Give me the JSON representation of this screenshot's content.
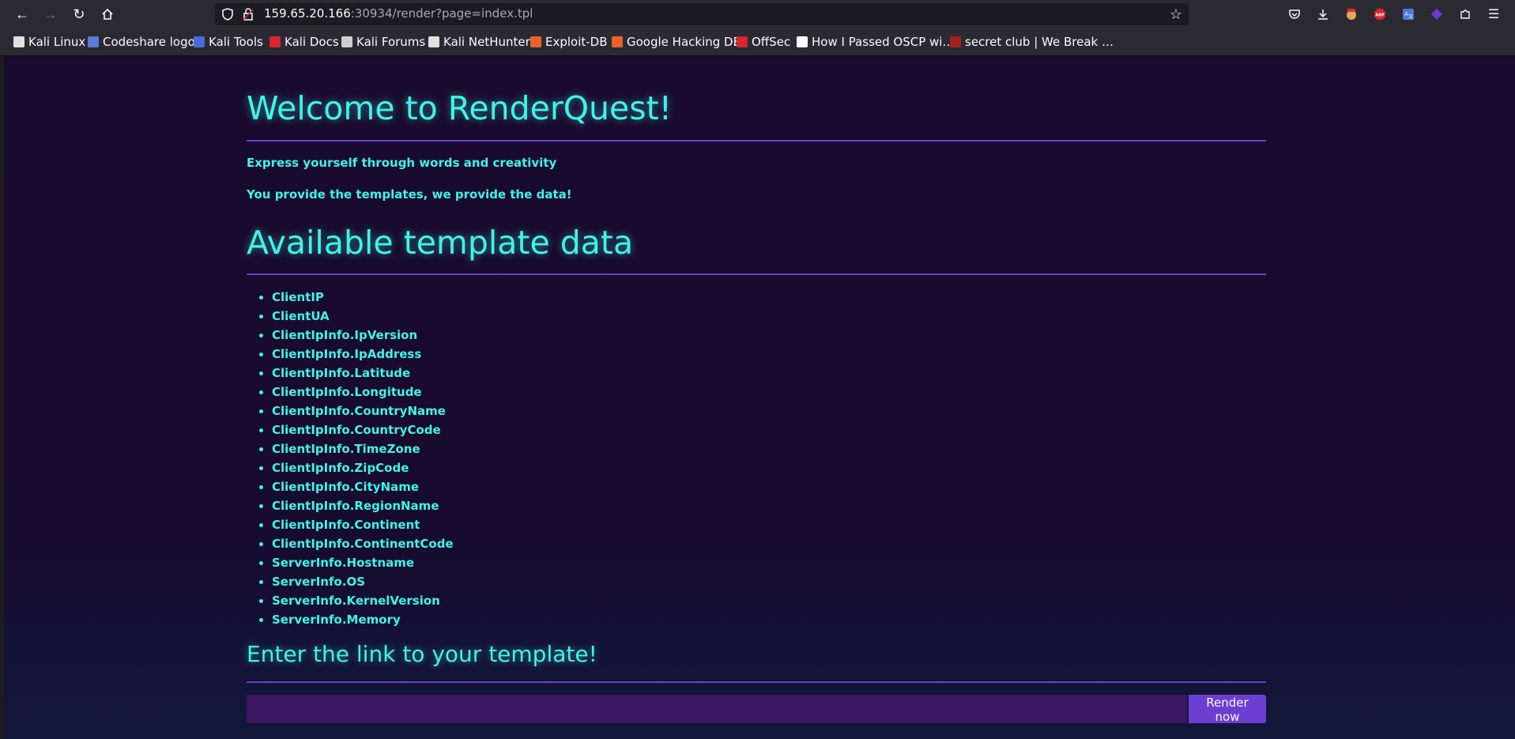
{
  "browser": {
    "url_host": "159.65.20.166",
    "url_rest": ":30934/render?page=index.tpl",
    "bookmarks": [
      {
        "label": "Kali Linux",
        "color": "#e0e0e0"
      },
      {
        "label": "Codeshare logo",
        "color": "#5a7bd6"
      },
      {
        "label": "Kali Tools",
        "color": "#4a6cd8"
      },
      {
        "label": "Kali Docs",
        "color": "#d8262b"
      },
      {
        "label": "Kali Forums",
        "color": "#cfcfcf"
      },
      {
        "label": "Kali NetHunter",
        "color": "#e0e0e0"
      },
      {
        "label": "Exploit-DB",
        "color": "#e8632a"
      },
      {
        "label": "Google Hacking DB",
        "color": "#e8632a"
      },
      {
        "label": "OffSec",
        "color": "#d8262b"
      },
      {
        "label": "How I Passed OSCP wi…",
        "color": "#ffffff"
      },
      {
        "label": "secret club | We Break …",
        "color": "#a32020"
      }
    ]
  },
  "page": {
    "title": "Welcome to RenderQuest!",
    "tagline1": "Express yourself through words and creativity",
    "tagline2": "You provide the templates, we provide the data!",
    "data_heading": "Available template data",
    "data_items": [
      "ClientIP",
      "ClientUA",
      "ClientIpInfo.IpVersion",
      "ClientIpInfo.IpAddress",
      "ClientIpInfo.Latitude",
      "ClientIpInfo.Longitude",
      "ClientIpInfo.CountryName",
      "ClientIpInfo.CountryCode",
      "ClientIpInfo.TimeZone",
      "ClientIpInfo.ZipCode",
      "ClientIpInfo.CityName",
      "ClientIpInfo.RegionName",
      "ClientIpInfo.Continent",
      "ClientIpInfo.ContinentCode",
      "ServerInfo.Hostname",
      "ServerInfo.OS",
      "ServerInfo.KernelVersion",
      "ServerInfo.Memory"
    ],
    "link_heading": "Enter the link to your template!",
    "input_value": "",
    "button_label": "Render now"
  }
}
